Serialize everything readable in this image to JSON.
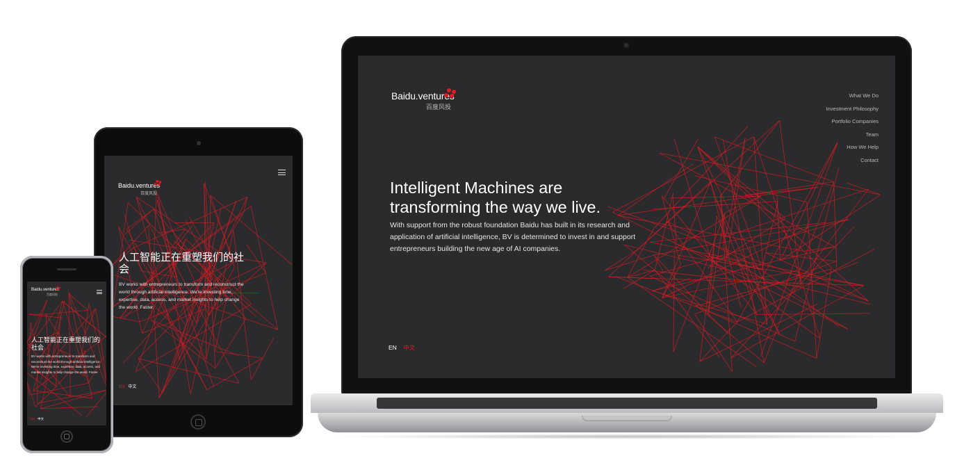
{
  "brand": {
    "name": "Baidu.ventures",
    "name_cn": "百度风投",
    "accent_color": "#e11b22"
  },
  "laptop": {
    "nav": [
      "What We Do",
      "Investment Philosophy",
      "Portfolio Companies",
      "Team",
      "How We Help",
      "Contact"
    ],
    "headline_line1": "Intelligent Machines are",
    "headline_line2": "transforming the way we live.",
    "body": "With support from the robust foundation Baidu has built in its research and application of artificial intelligence, BV is determined to invest in and support entrepreneurs building the new age of AI companies.",
    "lang_en": "EN",
    "lang_zh": "中文"
  },
  "tablet": {
    "headline": "人工智能正在重塑我们的社会",
    "body": "BV works with entrepreneurs to transform and reconstruct the world through artificial intelligence. We're investing time, expertise, data, access, and market insights to help change the world. Faster.",
    "lang_en": "EN",
    "lang_zh": "中文",
    "menu_icon": "hamburger-icon"
  },
  "phone": {
    "headline": "人工智能正在重塑我们的社会",
    "body": "BV works with entrepreneurs to transform and reconstruct the world through artificial intelligence. We're investing time, expertise, data, access, and market insights to help change the world. Faster.",
    "lang_en": "EN",
    "lang_zh": "中文",
    "menu_icon": "hamburger-icon"
  }
}
